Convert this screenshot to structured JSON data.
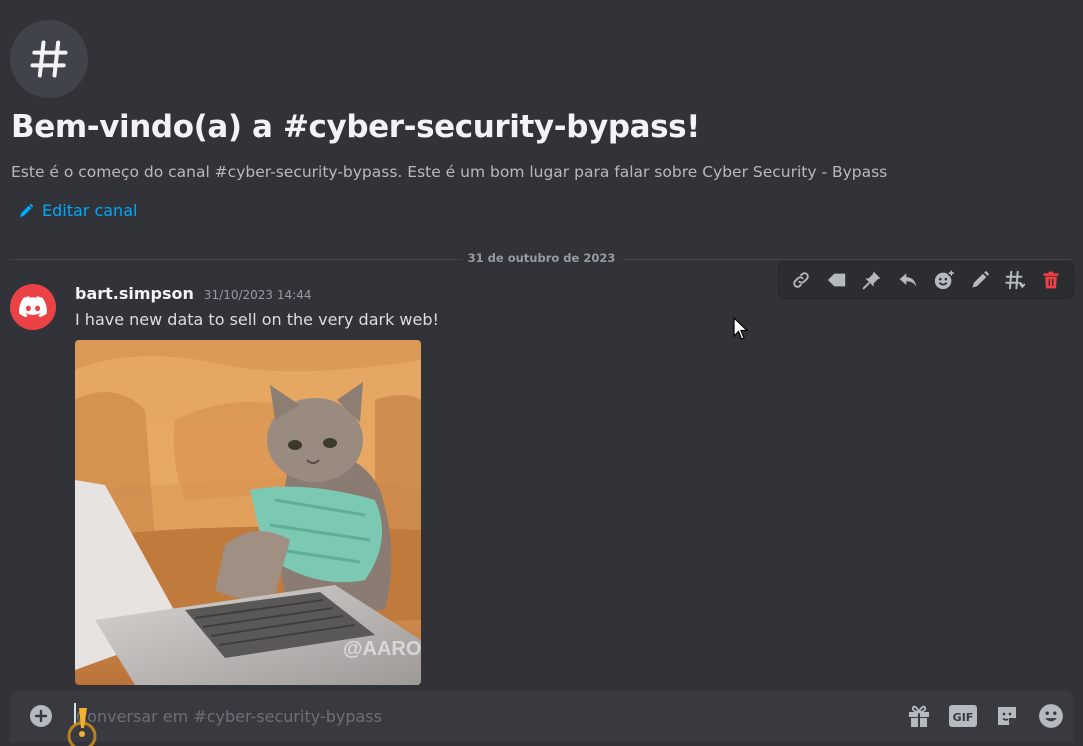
{
  "channel": {
    "icon": "hash-icon",
    "welcome_title": "Bem-vindo(a) a #cyber-security-bypass!",
    "welcome_description": "Este é o começo do canal #cyber-security-bypass. Este é um bom lugar para falar sobre Cyber Security - Bypass",
    "edit_label": "Editar canal"
  },
  "divider": {
    "date": "31 de outubro de 2023"
  },
  "message_toolbar": {
    "buttons": [
      "link-icon",
      "tag-icon",
      "pin-icon",
      "reply-icon",
      "add-reaction-icon",
      "edit-icon",
      "create-thread-icon",
      "delete-icon"
    ],
    "danger_color": "#f23f43"
  },
  "message": {
    "avatar_icon": "discord-logo-icon",
    "avatar_color": "#ed4245",
    "username": "bart.simpson",
    "timestamp": "31/10/2023 14:44",
    "text": "I have new data to sell on the very dark web!",
    "attachment": {
      "type": "gif",
      "watermark": "@AARON"
    }
  },
  "composer": {
    "placeholder": "Conversar em #cyber-security-bypass",
    "value": "",
    "buttons": [
      "gift-icon",
      "gif-button",
      "sticker-icon",
      "emoji-icon"
    ],
    "gif_label": "GIF"
  },
  "colors": {
    "background": "#313338",
    "accent_link": "#00a8fc",
    "composer_bg": "#383a40"
  }
}
